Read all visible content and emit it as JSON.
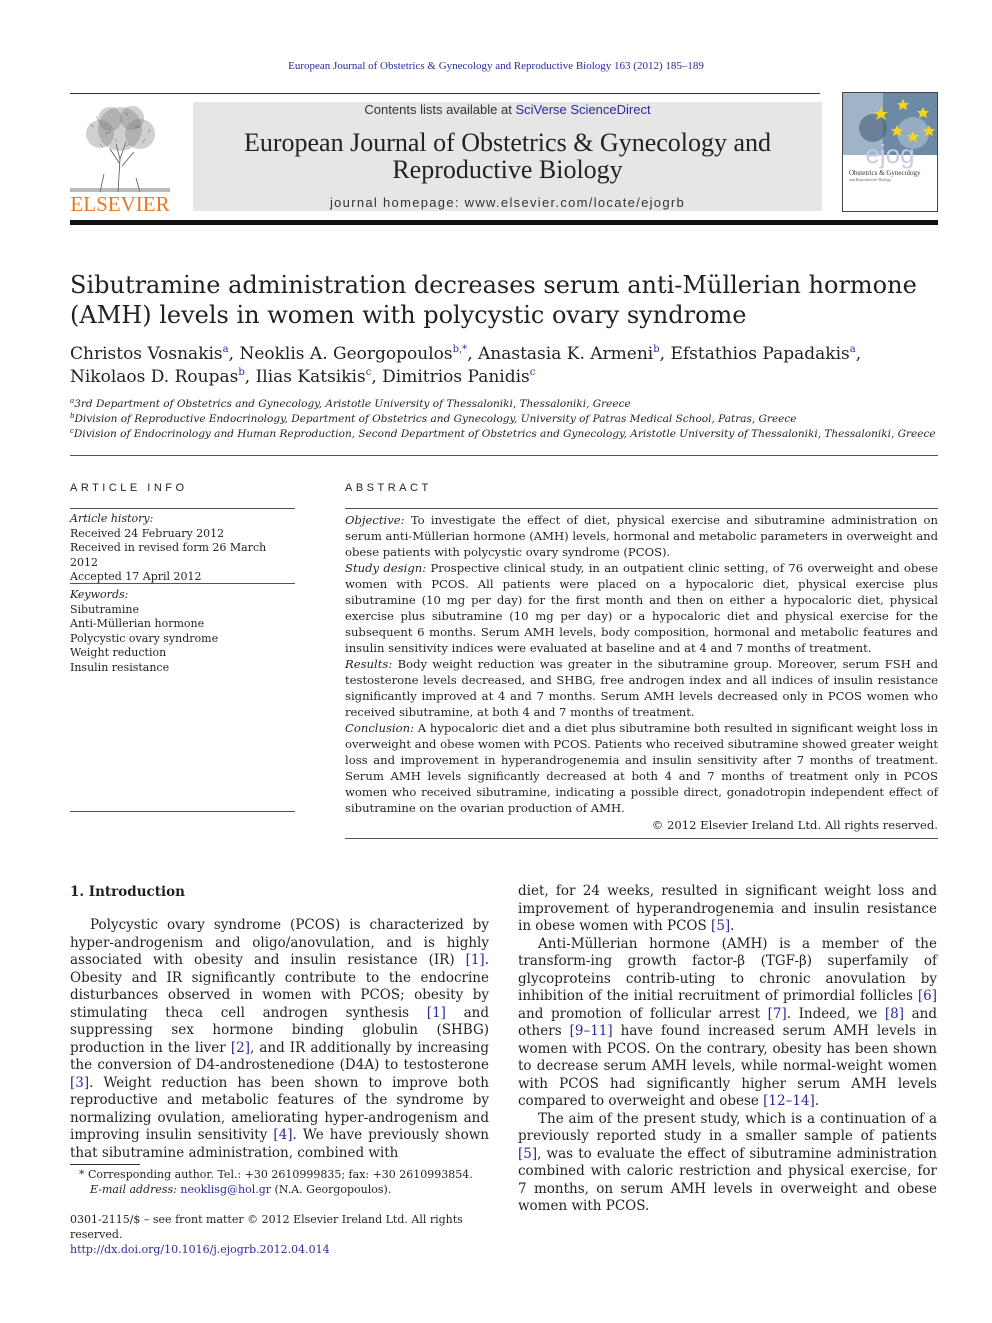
{
  "header": {
    "citation": "European Journal of Obstetrics & Gynecology and Reproductive Biology 163 (2012) 185–189",
    "contents_prefix": "Contents lists available at ",
    "contents_link": "SciVerse ScienceDirect",
    "journal_title_line1": "European Journal of Obstetrics & Gynecology and",
    "journal_title_line2": "Reproductive Biology",
    "homepage": "journal homepage: www.elsevier.com/locate/ejogrb",
    "publisher_logo": "ELSEVIER",
    "cover_logo": "ejog",
    "cover_subtitle": "Obstetrics & Gynecology",
    "cover_subtitle2": "and Reproductive Biology"
  },
  "article": {
    "title": "Sibutramine administration decreases serum anti-Müllerian hormone (AMH) levels in women with polycystic ovary syndrome",
    "authors": [
      {
        "name": "Christos Vosnakis",
        "sup": "a",
        "sep": ", "
      },
      {
        "name": "Neoklis A. Georgopoulos",
        "sup": "b,*",
        "sep": ", "
      },
      {
        "name": "Anastasia K. Armeni",
        "sup": "b",
        "sep": ", "
      },
      {
        "name": "Efstathios Papadakis",
        "sup": "a",
        "sep": ","
      },
      {
        "name": "Nikolaos D. Roupas",
        "sup": "b",
        "sep": ", "
      },
      {
        "name": "Ilias Katsikis",
        "sup": "c",
        "sep": ", "
      },
      {
        "name": "Dimitrios Panidis",
        "sup": "c",
        "sep": ""
      }
    ],
    "affiliations": [
      {
        "sup": "a",
        "text": "3rd Department of Obstetrics and Gynecology, Aristotle University of Thessaloniki, Thessaloniki, Greece"
      },
      {
        "sup": "b",
        "text": "Division of Reproductive Endocrinology, Department of Obstetrics and Gynecology, University of Patras Medical School, Patras, Greece"
      },
      {
        "sup": "c",
        "text": "Division of Endocrinology and Human Reproduction, Second Department of Obstetrics and Gynecology, Aristotle University of Thessaloniki, Thessaloniki, Greece"
      }
    ]
  },
  "article_info": {
    "heading": "ARTICLE INFO",
    "history_label": "Article history:",
    "received": "Received 24 February 2012",
    "revised": "Received in revised form 26 March 2012",
    "accepted": "Accepted 17 April 2012",
    "keywords_label": "Keywords:",
    "keywords": [
      "Sibutramine",
      "Anti-Müllerian hormone",
      "Polycystic ovary syndrome",
      "Weight reduction",
      "Insulin resistance"
    ]
  },
  "abstract": {
    "heading": "ABSTRACT",
    "sections": [
      {
        "label": "Objective:",
        "text": " To investigate the effect of diet, physical exercise and sibutramine administration on serum anti-Müllerian hormone (AMH) levels, hormonal and metabolic parameters in overweight and obese patients with polycystic ovary syndrome (PCOS)."
      },
      {
        "label": "Study design:",
        "text": " Prospective clinical study, in an outpatient clinic setting, of 76 overweight and obese women with PCOS. All patients were placed on a hypocaloric diet, physical exercise plus sibutramine (10 mg per day) for the first month and then on either a hypocaloric diet, physical exercise plus sibutramine (10 mg per day) or a hypocaloric diet and physical exercise for the subsequent 6 months. Serum AMH levels, body composition, hormonal and metabolic features and insulin sensitivity indices were evaluated at baseline and at 4 and 7 months of treatment."
      },
      {
        "label": "Results:",
        "text": " Body weight reduction was greater in the sibutramine group. Moreover, serum FSH and testosterone levels decreased, and SHBG, free androgen index and all indices of insulin resistance significantly improved at 4 and 7 months. Serum AMH levels decreased only in PCOS women who received sibutramine, at both 4 and 7 months of treatment."
      },
      {
        "label": "Conclusion:",
        "text": " A hypocaloric diet and a diet plus sibutramine both resulted in significant weight loss in overweight and obese women with PCOS. Patients who received sibutramine showed greater weight loss and improvement in hyperandrogenemia and insulin sensitivity after 7 months of treatment. Serum AMH levels significantly decreased at both 4 and 7 months of treatment only in PCOS women who received sibutramine, indicating a possible direct, gonadotropin independent effect of sibutramine on the ovarian production of AMH."
      }
    ],
    "copyright": "© 2012 Elsevier Ireland Ltd. All rights reserved."
  },
  "intro": {
    "heading": "1.  Introduction",
    "left_paragraph": [
      {
        "t": "Polycystic ovary syndrome (PCOS) is characterized by hyper-androgenism and oligo/anovulation, and is highly associated with obesity and insulin resistance (IR) "
      },
      {
        "ref": "[1]"
      },
      {
        "t": ". Obesity and IR significantly contribute to the endocrine disturbances observed in women with PCOS; obesity by stimulating theca cell androgen synthesis "
      },
      {
        "ref": "[1]"
      },
      {
        "t": " and suppressing sex hormone binding globulin (SHBG) production in the liver "
      },
      {
        "ref": "[2]"
      },
      {
        "t": ", and IR additionally by increasing the conversion of D4-androstenedione (D4A) to testosterone "
      },
      {
        "ref": "[3]"
      },
      {
        "t": ". Weight reduction has been shown to improve both reproductive and metabolic features of the syndrome by normalizing ovulation, ameliorating hyper-androgenism and improving insulin sensitivity "
      },
      {
        "ref": "[4]"
      },
      {
        "t": ". We have previously shown that sibutramine administration, combined with"
      }
    ],
    "right_p1": [
      {
        "t": "diet, for 24 weeks, resulted in significant weight loss and improvement of hyperandrogenemia and insulin resistance in obese women with PCOS "
      },
      {
        "ref": "[5]"
      },
      {
        "t": "."
      }
    ],
    "right_p2": [
      {
        "t": "Anti-Müllerian hormone (AMH) is a member of the transform-ing growth factor-β (TGF-β) superfamily of glycoproteins contrib-uting to chronic anovulation by inhibition of the initial recruitment of primordial follicles "
      },
      {
        "ref": "[6]"
      },
      {
        "t": " and promotion of follicular arrest "
      },
      {
        "ref": "[7]"
      },
      {
        "t": ". Indeed, we "
      },
      {
        "ref": "[8]"
      },
      {
        "t": " and others "
      },
      {
        "ref": "[9–11]"
      },
      {
        "t": " have found increased serum AMH levels in women with PCOS. On the contrary, obesity has been shown to decrease serum AMH levels, while normal-weight women with PCOS had significantly higher serum AMH levels compared to overweight and obese "
      },
      {
        "ref": "[12–14]"
      },
      {
        "t": "."
      }
    ],
    "right_p3": [
      {
        "t": "The aim of the present study, which is a continuation of a previously reported study in a smaller sample of patients "
      },
      {
        "ref": "[5]"
      },
      {
        "t": ", was to evaluate the effect of sibutramine administration combined with caloric restriction and physical exercise, for 7 months, on serum AMH levels in overweight and obese women with PCOS."
      }
    ]
  },
  "footnote": {
    "star": "*",
    "corresponding": " Corresponding author. Tel.: +30 2610999835; fax: +30 2610993854.",
    "email_label": "E-mail address:",
    "email": "neoklisg@hol.gr",
    "email_suffix": " (N.A. Georgopoulos)."
  },
  "front_matter": {
    "issn_line": "0301-2115/$ – see front matter © 2012 Elsevier Ireland Ltd. All rights reserved.",
    "doi": "http://dx.doi.org/10.1016/j.ejogrb.2012.04.014"
  }
}
